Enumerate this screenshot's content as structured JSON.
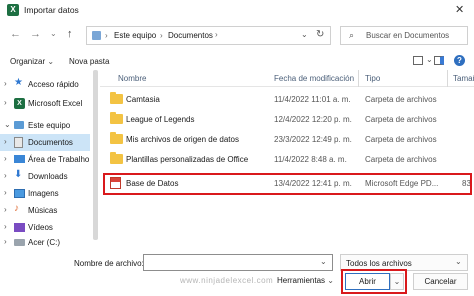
{
  "window": {
    "title": "Importar datos"
  },
  "nav": {
    "breadcrumb": [
      "Este equipo",
      "Documentos"
    ],
    "search_placeholder": "Buscar en Documentos"
  },
  "toolbar": {
    "organize_label": "Organizar",
    "new_folder_label": "Nova pasta"
  },
  "sidebar": {
    "items": [
      {
        "label": "Acceso rápido",
        "icon": "star-icon"
      },
      {
        "label": "Microsoft Excel",
        "icon": "excel-icon"
      },
      {
        "label": "Este equipo",
        "icon": "computer-icon"
      },
      {
        "label": "Documentos",
        "icon": "documents-icon"
      },
      {
        "label": "Área de Trabalho",
        "icon": "desktop-icon"
      },
      {
        "label": "Downloads",
        "icon": "download-icon"
      },
      {
        "label": "Imagens",
        "icon": "pictures-icon"
      },
      {
        "label": "Músicas",
        "icon": "music-icon"
      },
      {
        "label": "Vídeos",
        "icon": "videos-icon"
      },
      {
        "label": "Acer (C:)",
        "icon": "drive-icon"
      }
    ]
  },
  "columns": {
    "name": "Nombre",
    "date": "Fecha de modificación",
    "type": "Tipo",
    "size": "Tamaño"
  },
  "files": [
    {
      "name": "Camtasia",
      "date": "11/4/2022 11:01 a. m.",
      "type": "Carpeta de archivos",
      "size": "",
      "icon": "folder-icon"
    },
    {
      "name": "League of Legends",
      "date": "12/4/2022 12:20 p. m.",
      "type": "Carpeta de archivos",
      "size": "",
      "icon": "folder-icon"
    },
    {
      "name": "Mis archivos de origen de datos",
      "date": "23/3/2022 12:49 p. m.",
      "type": "Carpeta de archivos",
      "size": "",
      "icon": "folder-icon"
    },
    {
      "name": "Plantillas personalizadas de Office",
      "date": "11/4/2022 8:48 a. m.",
      "type": "Carpeta de archivos",
      "size": "",
      "icon": "folder-icon"
    },
    {
      "name": "Base de Datos",
      "date": "13/4/2022 12:41 p. m.",
      "type": "Microsoft Edge PD...",
      "size": "83",
      "icon": "pdf-file-icon"
    }
  ],
  "bottom": {
    "filename_label": "Nombre de archivo:",
    "filename_value": "",
    "filetype_value": "Todos los archivos",
    "tools_label": "Herramientas",
    "open_label": "Abrir",
    "cancel_label": "Cancelar",
    "watermark": "www.ninjadelexcel.com"
  },
  "colors": {
    "highlight": "#d9191c",
    "selection": "#cce4f7",
    "folder": "#f3c343",
    "excel": "#1d6f42"
  }
}
